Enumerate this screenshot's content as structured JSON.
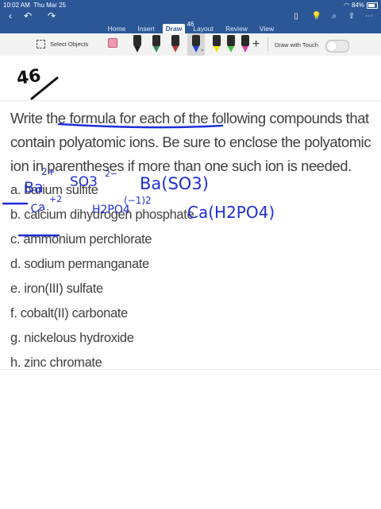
{
  "status_bar": {
    "time": "10:02 AM",
    "date": "Thu Mar 25",
    "battery": "84%"
  },
  "document_title": "46",
  "ribbon_tabs": [
    {
      "label": "Home",
      "active": false
    },
    {
      "label": "Insert",
      "active": false
    },
    {
      "label": "Draw",
      "active": true
    },
    {
      "label": "Layout",
      "active": false
    },
    {
      "label": "Review",
      "active": false
    },
    {
      "label": "View",
      "active": false
    }
  ],
  "draw_ribbon": {
    "select_objects_label": "Select Objects",
    "draw_with_touch_label": "Draw with Touch",
    "draw_with_touch_on": false,
    "tools": [
      {
        "name": "eraser",
        "color": "#f19ab1"
      },
      {
        "name": "pen-black",
        "color": "#222222"
      },
      {
        "name": "pen-green",
        "color": "#2e8b57"
      },
      {
        "name": "pen-red",
        "color": "#c0392b"
      },
      {
        "name": "pen-blue",
        "color": "#1e3fd8",
        "selected": true
      },
      {
        "name": "highlighter-yellow",
        "color": "#f2e600"
      },
      {
        "name": "highlighter-green",
        "color": "#39c739"
      },
      {
        "name": "highlighter-pink",
        "color": "#e23aa5"
      }
    ]
  },
  "document": {
    "question": "Write the formula for each of the following compounds that contain polyatomic ions. Be sure to enclose the polyatomic ion in parentheses if more than one such ion is needed.",
    "items": [
      "a. barium sulfite",
      "b. calcium dihydrogen phosphate",
      "c. ammonium perchlorate",
      "d. sodium permanganate",
      "e. iron(III) sulfate",
      "f. cobalt(II) carbonate",
      "g. nickelous hydroxide",
      "h. zinc chromate"
    ]
  },
  "annotations": {
    "problem_number": "46",
    "ink_colors": {
      "black": "#111111",
      "blue": "#1e2fd8"
    },
    "handwriting": {
      "ba_ion": "Ba",
      "ba_charge": "2+",
      "so3_ion": "SO3",
      "so3_charge": "2−",
      "ba_formula": "Ba(SO3)",
      "ca_ion": "Ca",
      "ca_charge": "+2",
      "h2po4_ion": "H2PO4",
      "h2po4_charge": "(−1)2",
      "ca_formula": "Ca(H2PO4)"
    }
  }
}
